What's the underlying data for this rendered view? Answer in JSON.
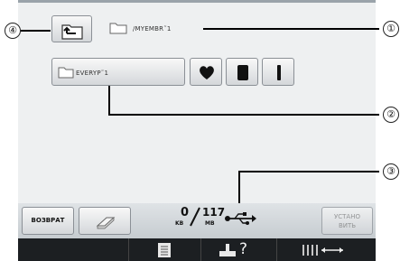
{
  "callouts": [
    "④",
    "①",
    "②",
    "③"
  ],
  "path": {
    "current_folder": "/MYEMBR˜1"
  },
  "folder_button": {
    "label": "EVERYP˜1"
  },
  "status": {
    "used_value": "0",
    "used_unit": "KB",
    "total_value": "117",
    "total_unit": "MB"
  },
  "buttons": {
    "back_label": "ВОЗВРАТ",
    "set_label_line1": "УСТАНО",
    "set_label_line2": "ВИТЬ"
  },
  "tabs": {
    "help_mark": "?"
  }
}
